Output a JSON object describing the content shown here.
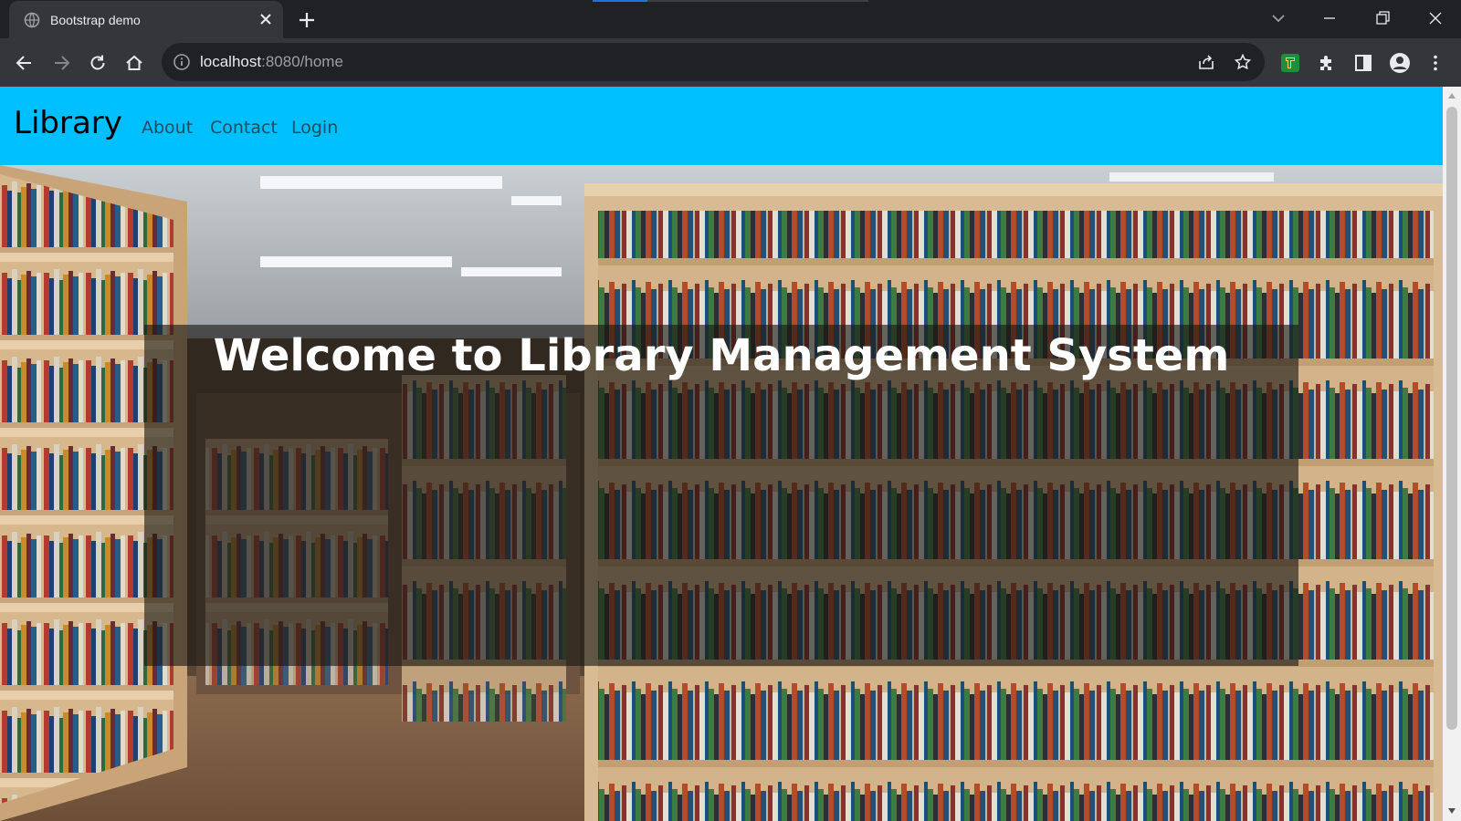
{
  "browser": {
    "tab": {
      "title": "Bootstrap demo",
      "favicon": "globe-icon",
      "close": "close-icon"
    },
    "new_tab": "plus-icon",
    "tab_search": "chevron-down-icon",
    "window_controls": [
      "minimize-icon",
      "restore-icon",
      "close-icon"
    ],
    "nav": [
      "back-icon",
      "forward-icon",
      "reload-icon",
      "home-icon"
    ],
    "address": {
      "host": "localhost",
      "rest": ":8080/home",
      "info_icon": "info-icon"
    },
    "omnibox_icons": [
      "share-icon",
      "star-icon"
    ],
    "extensions": [
      "extension-green-icon",
      "puzzle-icon",
      "sidepanel-icon",
      "profile-icon",
      "menu-icon"
    ]
  },
  "navbar": {
    "brand": "Library",
    "links": [
      "About",
      "Contact",
      "Login"
    ],
    "background": "#00bfff"
  },
  "hero": {
    "heading": "Welcome to Library Management System",
    "background_image": "library bookshelves"
  }
}
